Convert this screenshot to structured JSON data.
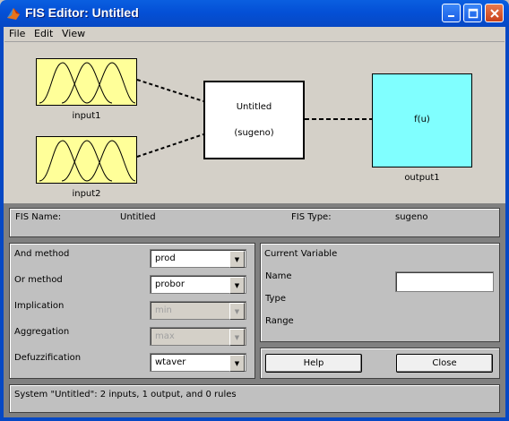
{
  "window": {
    "title": "FIS Editor: Untitled",
    "app_icon": "matlab-icon"
  },
  "menubar": {
    "items": [
      "File",
      "Edit",
      "View"
    ]
  },
  "diagram": {
    "inputs": [
      {
        "label": "input1"
      },
      {
        "label": "input2"
      }
    ],
    "system": {
      "name": "Untitled",
      "type_label": "(sugeno)"
    },
    "output": {
      "function": "f(u)",
      "label": "output1"
    },
    "colors": {
      "input_block": "#ffff99",
      "output_block": "#80ffff",
      "system_block": "#ffffff"
    }
  },
  "fis_info": {
    "name_label": "FIS Name:",
    "name_value": "Untitled",
    "type_label": "FIS Type:",
    "type_value": "sugeno"
  },
  "methods": [
    {
      "label": "And method",
      "value": "prod",
      "enabled": true
    },
    {
      "label": "Or method",
      "value": "probor",
      "enabled": true
    },
    {
      "label": "Implication",
      "value": "min",
      "enabled": false
    },
    {
      "label": "Aggregation",
      "value": "max",
      "enabled": false
    },
    {
      "label": "Defuzzification",
      "value": "wtaver",
      "enabled": true
    }
  ],
  "current_variable": {
    "heading": "Current Variable",
    "name_label": "Name",
    "name_value": "",
    "type_label": "Type",
    "range_label": "Range"
  },
  "buttons": {
    "help": "Help",
    "close": "Close"
  },
  "status": "System \"Untitled\": 2 inputs, 1 output, and 0 rules"
}
